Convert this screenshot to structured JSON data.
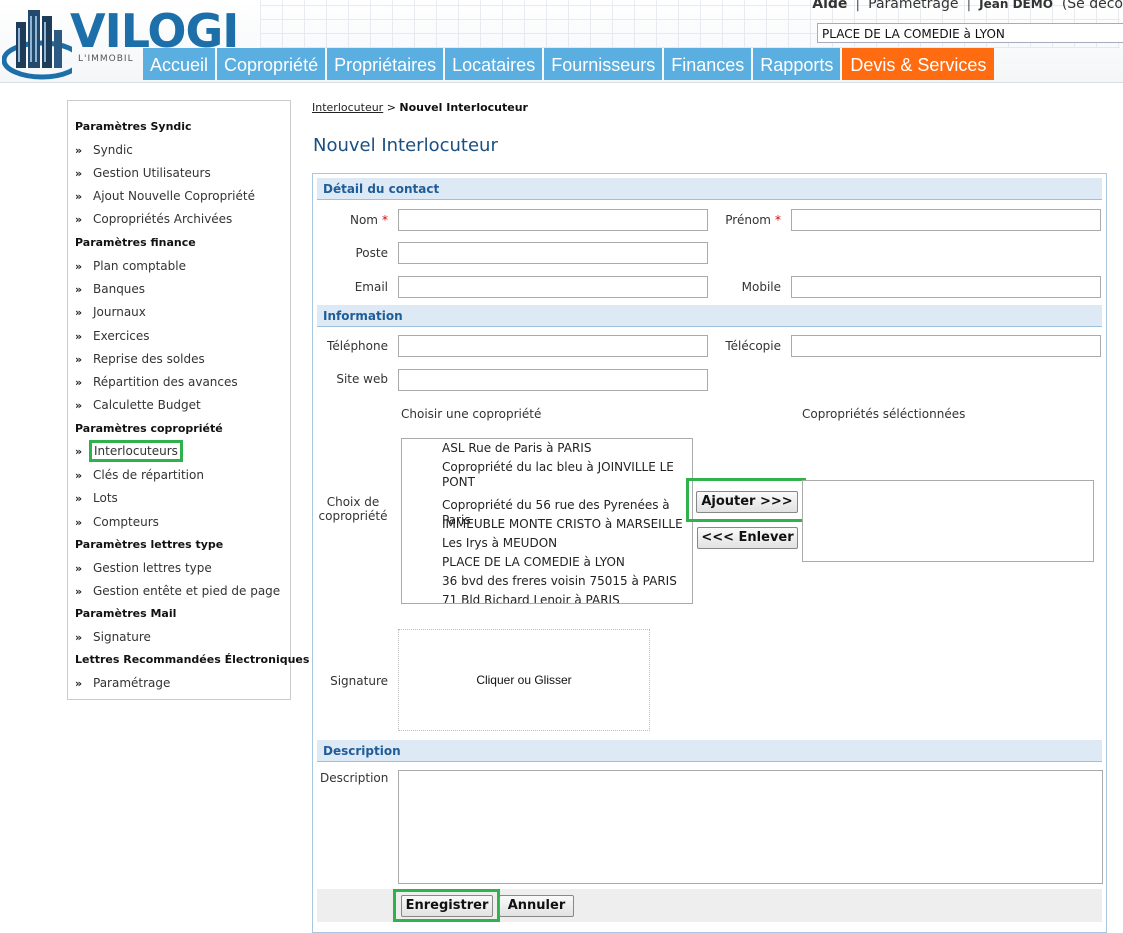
{
  "header": {
    "logo_text": "VILOGI",
    "logo_subtitle": "L'IMMOBIL",
    "links": {
      "aide": "Aide",
      "parametrage": "Paramétrage",
      "user": "Jean DEMO",
      "logout": "(Se déco"
    },
    "copro_selected": "PLACE DE LA COMEDIE à LYON",
    "tabs": [
      {
        "label": "Accueil"
      },
      {
        "label": "Copropriété"
      },
      {
        "label": "Propriétaires"
      },
      {
        "label": "Locataires"
      },
      {
        "label": "Fournisseurs"
      },
      {
        "label": "Finances"
      },
      {
        "label": "Rapports"
      },
      {
        "label": "Devis & Services"
      }
    ],
    "colors": {
      "tab": "#5aaee0",
      "tab_active": "#ff6b10",
      "logo": "#1c6fa8"
    }
  },
  "sidebar": {
    "items": [
      {
        "label": "Paramètres Syndic",
        "heading": true
      },
      {
        "label": "Syndic"
      },
      {
        "label": "Gestion Utilisateurs"
      },
      {
        "label": "Ajout Nouvelle Copropriété"
      },
      {
        "label": "Copropriétés Archivées"
      },
      {
        "label": "Paramètres finance",
        "heading": true
      },
      {
        "label": "Plan comptable"
      },
      {
        "label": "Banques"
      },
      {
        "label": "Journaux"
      },
      {
        "label": "Exercices"
      },
      {
        "label": "Reprise des soldes"
      },
      {
        "label": "Répartition des avances"
      },
      {
        "label": "Calculette Budget"
      },
      {
        "label": "Paramètres copropriété",
        "heading": true
      },
      {
        "label": "Interlocuteurs",
        "highlight": true
      },
      {
        "label": "Clés de répartition"
      },
      {
        "label": "Lots"
      },
      {
        "label": "Compteurs"
      },
      {
        "label": "Paramètres lettres type",
        "heading": true
      },
      {
        "label": "Gestion lettres type"
      },
      {
        "label": "Gestion entête et pied de page"
      },
      {
        "label": "Paramètres Mail",
        "heading": true
      },
      {
        "label": "Signature"
      },
      {
        "label": "Lettres Recommandées Électroniques",
        "heading": true
      },
      {
        "label": "Paramétrage"
      }
    ],
    "bullet": "»"
  },
  "breadcrumb": {
    "parent": "Interlocuteur",
    "separator": ">",
    "current": "Nouvel Interlocuteur"
  },
  "page_title": "Nouvel Interlocuteur",
  "form": {
    "section_contact": "Détail du contact",
    "nom_label": "Nom",
    "prenom_label": "Prénom",
    "required_mark": "*",
    "poste_label": "Poste",
    "email_label": "Email",
    "mobile_label": "Mobile",
    "section_info": "Information",
    "telephone_label": "Téléphone",
    "telecopie_label": "Télécopie",
    "siteweb_label": "Site web",
    "choisir_title": "Choisir une copropriété",
    "selectionnees_title": "Copropriétés séléctionnées",
    "choix_label_1": "Choix de",
    "choix_label_2": "copropriété",
    "coproprietes": [
      "ASL Rue de Paris à PARIS",
      "Copropriété du lac bleu à JOINVILLE LE PONT",
      "Copropriété du 56 rue des Pyrenées à Paris",
      "IMMEUBLE MONTE CRISTO à MARSEILLE",
      "Les Irys à MEUDON",
      "PLACE DE LA COMEDIE à LYON",
      "36 bvd des freres voisin 75015 à PARIS",
      "71 Bld Richard Lenoir à PARIS"
    ],
    "ajouter_label": "Ajouter >>>",
    "enlever_label": "<<< Enlever",
    "signature_label": "Signature",
    "signature_hint": "Cliquer ou Glisser",
    "section_description": "Description",
    "description_label": "Description",
    "enregistrer_label": "Enregistrer",
    "annuler_label": "Annuler"
  }
}
